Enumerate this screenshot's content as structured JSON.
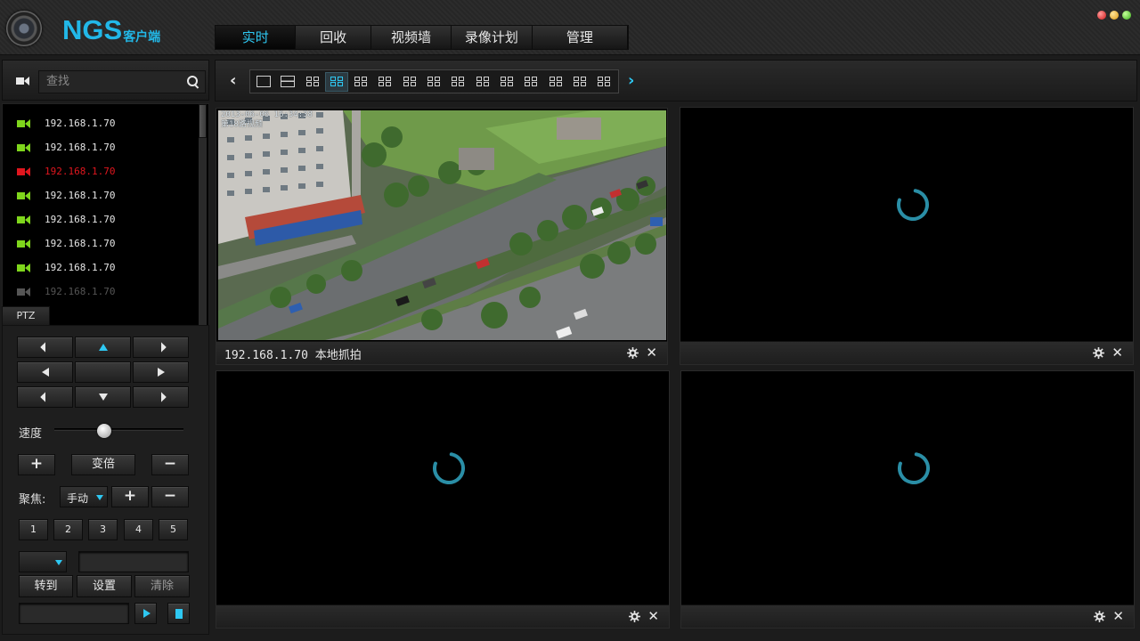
{
  "app": {
    "brand_main": "NGS",
    "brand_sub": "客户端"
  },
  "nav": {
    "tabs": [
      {
        "label": "实时",
        "active": true
      },
      {
        "label": "回收",
        "active": false
      },
      {
        "label": "视频墙",
        "active": false
      },
      {
        "label": "录像计划",
        "active": false
      },
      {
        "label": "管理",
        "active": false
      }
    ]
  },
  "window_controls": [
    "close-dot",
    "minimize-dot",
    "maximize-dot"
  ],
  "colors": {
    "accent": "#2ec8f2",
    "online": "#7fd61c",
    "alarm": "#e0161e",
    "offline": "#555555"
  },
  "sidebar": {
    "search_placeholder": "查找",
    "devices": [
      {
        "ip": "192.168.1.70",
        "status": "online"
      },
      {
        "ip": "192.168.1.70",
        "status": "online"
      },
      {
        "ip": "192.168.1.70",
        "status": "alarm"
      },
      {
        "ip": "192.168.1.70",
        "status": "online"
      },
      {
        "ip": "192.168.1.70",
        "status": "online"
      },
      {
        "ip": "192.168.1.70",
        "status": "online"
      },
      {
        "ip": "192.168.1.70",
        "status": "online"
      },
      {
        "ip": "192.168.1.70",
        "status": "offline"
      }
    ]
  },
  "ptz": {
    "tab_label": "PTZ",
    "speed_label": "速度",
    "speed_value": 0.35,
    "zoom_plus": "+",
    "zoom_label": "变倍",
    "zoom_minus": "−",
    "focus_label": "聚焦:",
    "focus_mode": "手动",
    "focus_plus": "+",
    "focus_minus": "−",
    "presets": [
      "1",
      "2",
      "3",
      "4",
      "5"
    ],
    "goto_label": "转到",
    "set_label": "设置",
    "clear_label": "清除"
  },
  "toolbar": {
    "layout_count": 15,
    "active_layout": 3
  },
  "video": {
    "pane1_caption": "192.168.1.70 本地抓拍",
    "pane1_osd_time": "2013-06-06 16:34:38",
    "pane1_osd_channel": "第18路视频"
  }
}
